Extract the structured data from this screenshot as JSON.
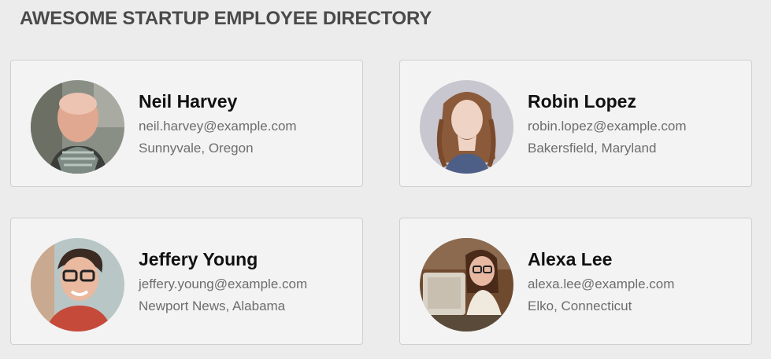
{
  "header": {
    "title": "AWESOME STARTUP EMPLOYEE DIRECTORY"
  },
  "employees": [
    {
      "name": "Neil Harvey",
      "email": "neil.harvey@example.com",
      "location": "Sunnyvale, Oregon",
      "avatar": "man-with-scarf-photo"
    },
    {
      "name": "Robin Lopez",
      "email": "robin.lopez@example.com",
      "location": "Bakersfield, Maryland",
      "avatar": "woman-curly-hair-photo"
    },
    {
      "name": "Jeffery Young",
      "email": "jeffery.young@example.com",
      "location": "Newport News, Alabama",
      "avatar": "man-with-glasses-photo"
    },
    {
      "name": "Alexa Lee",
      "email": "alexa.lee@example.com",
      "location": "Elko, Connecticut",
      "avatar": "woman-at-computer-photo"
    }
  ],
  "colors": {
    "background": "#ececec",
    "card": "#f3f3f3",
    "title": "#4a4a4a",
    "secondary_text": "#6d6d6d"
  }
}
